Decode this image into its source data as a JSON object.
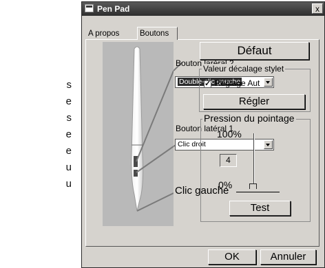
{
  "side_text": [
    "s",
    "e",
    "s",
    "e",
    "e",
    "u",
    "u"
  ],
  "window": {
    "title": "Pen Pad",
    "close_label": "x",
    "tabs": [
      {
        "label": "A propos"
      },
      {
        "label": "Boutons"
      }
    ],
    "side_button_2": {
      "label": "Bouton laréral 2",
      "value": "Double-clic gauche"
    },
    "side_button_1": {
      "label": "Bouton latéral 1",
      "value": "Clic droit"
    },
    "left_click_label": "Clic gauche",
    "default_button": "Défaut",
    "offset_group": {
      "title": "Valeur décalage stylet",
      "checkbox_label": "Réglage Aut",
      "checkbox_checked": true,
      "adjust_button": "Régler"
    },
    "pressure_group": {
      "title": "Pression du pointage",
      "max_label": "100%",
      "value": "4",
      "min_label": "0%",
      "test_button": "Test"
    },
    "ok_button": "OK",
    "cancel_button": "Annuler"
  }
}
